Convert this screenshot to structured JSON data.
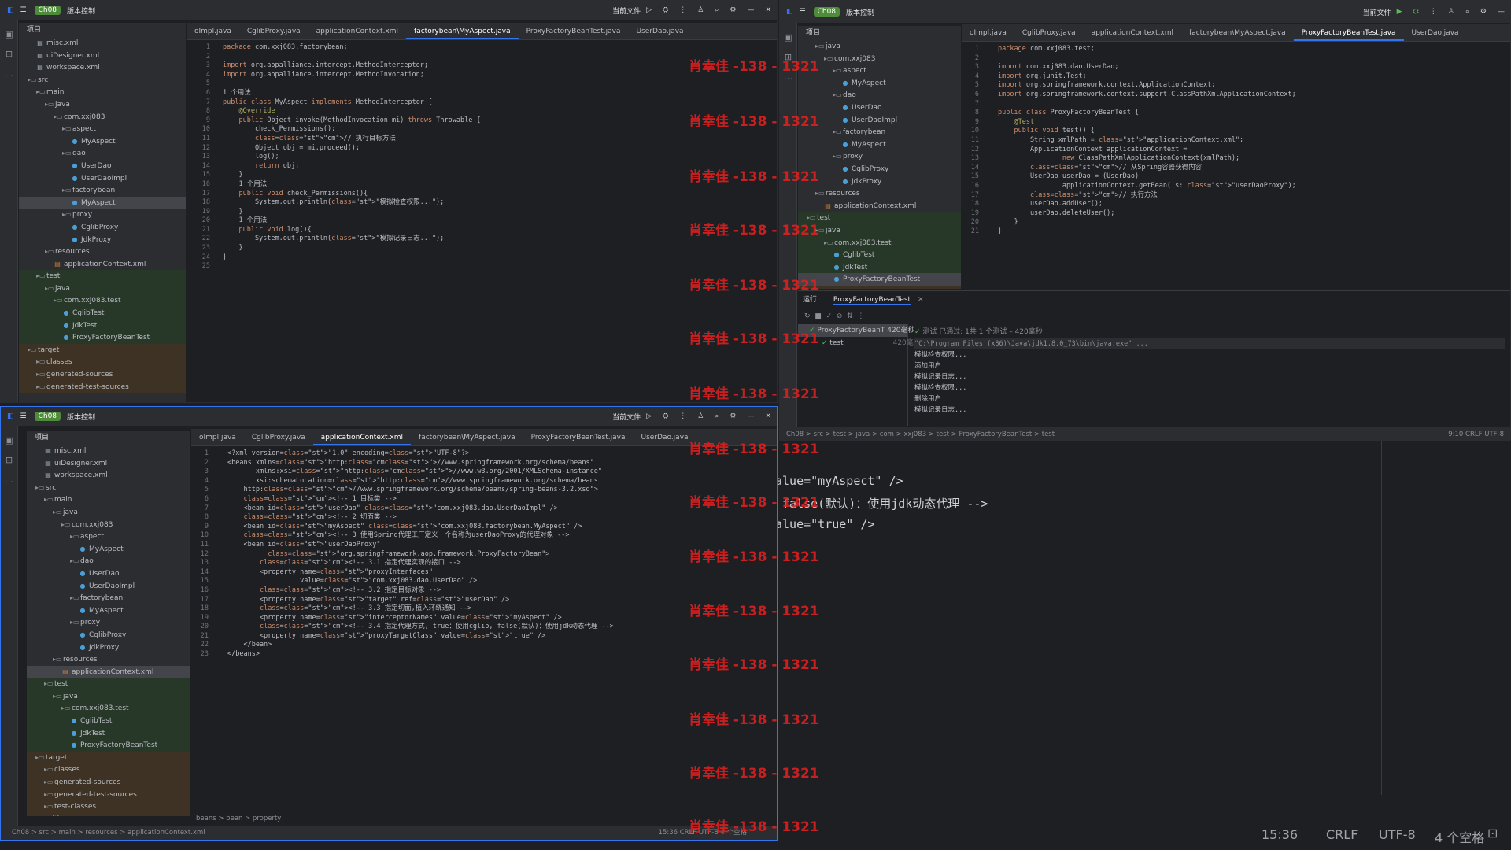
{
  "project": "Ch08",
  "vcs": "版本控制",
  "cur_file": "当前文件",
  "tree_root": "项目",
  "tree": [
    [
      "misc.xml",
      "f",
      2
    ],
    [
      "uiDesigner.xml",
      "f",
      2
    ],
    [
      "workspace.xml",
      "f",
      2
    ],
    [
      "src",
      "d",
      1
    ],
    [
      "main",
      "d",
      2
    ],
    [
      "java",
      "d",
      3
    ],
    [
      "com.xxj083",
      "d",
      4
    ],
    [
      "aspect",
      "d",
      5
    ],
    [
      "MyAspect",
      "c",
      6
    ],
    [
      "dao",
      "d",
      5
    ],
    [
      "UserDao",
      "c",
      6
    ],
    [
      "UserDaoImpl",
      "c",
      6
    ],
    [
      "factorybean",
      "d",
      5
    ],
    [
      "MyAspect",
      "c",
      6
    ],
    [
      "proxy",
      "d",
      5
    ],
    [
      "CglibProxy",
      "c",
      6
    ],
    [
      "JdkProxy",
      "c",
      6
    ],
    [
      "resources",
      "d",
      3
    ],
    [
      "applicationContext.xml",
      "x",
      4
    ],
    [
      "test",
      "d",
      2
    ],
    [
      "java",
      "d",
      3
    ],
    [
      "com.xxj083.test",
      "d",
      4
    ],
    [
      "CglibTest",
      "c",
      5
    ],
    [
      "JdkTest",
      "c",
      5
    ],
    [
      "ProxyFactoryBeanTest",
      "c",
      5
    ],
    [
      "target",
      "d",
      1
    ],
    [
      "classes",
      "d",
      2
    ],
    [
      "generated-sources",
      "d",
      2
    ],
    [
      "generated-test-sources",
      "d",
      2
    ]
  ],
  "tree_b": [
    [
      "misc.xml",
      "f",
      2
    ],
    [
      "uiDesigner.xml",
      "f",
      2
    ],
    [
      "workspace.xml",
      "f",
      2
    ],
    [
      "src",
      "d",
      1
    ],
    [
      "main",
      "d",
      2
    ],
    [
      "java",
      "d",
      3
    ],
    [
      "com.xxj083",
      "d",
      4
    ],
    [
      "aspect",
      "d",
      5
    ],
    [
      "MyAspect",
      "c",
      6
    ],
    [
      "dao",
      "d",
      5
    ],
    [
      "UserDao",
      "c",
      6
    ],
    [
      "UserDaoImpl",
      "c",
      6
    ],
    [
      "factorybean",
      "d",
      5
    ],
    [
      "MyAspect",
      "c",
      6
    ],
    [
      "proxy",
      "d",
      5
    ],
    [
      "CglibProxy",
      "c",
      6
    ],
    [
      "JdkProxy",
      "c",
      6
    ],
    [
      "resources",
      "d",
      3
    ],
    [
      "applicationContext.xml",
      "x",
      4
    ],
    [
      "test",
      "d",
      2
    ],
    [
      "java",
      "d",
      3
    ],
    [
      "com.xxj083.test",
      "d",
      4
    ],
    [
      "CglibTest",
      "c",
      5
    ],
    [
      "JdkTest",
      "c",
      5
    ],
    [
      "ProxyFactoryBeanTest",
      "c",
      5
    ],
    [
      "target",
      "d",
      1
    ],
    [
      "classes",
      "d",
      2
    ],
    [
      "generated-sources",
      "d",
      2
    ],
    [
      "generated-test-sources",
      "d",
      2
    ],
    [
      "test-classes",
      "d",
      2
    ],
    [
      ".gitignore",
      "f",
      1
    ]
  ],
  "tree_r": [
    [
      "java",
      "d",
      2
    ],
    [
      "com.xxj083",
      "d",
      3
    ],
    [
      "aspect",
      "d",
      4
    ],
    [
      "MyAspect",
      "c",
      5
    ],
    [
      "dao",
      "d",
      4
    ],
    [
      "UserDao",
      "c",
      5
    ],
    [
      "UserDaoImpl",
      "c",
      5
    ],
    [
      "factorybean",
      "d",
      4
    ],
    [
      "MyAspect",
      "c",
      5
    ],
    [
      "proxy",
      "d",
      4
    ],
    [
      "CglibProxy",
      "c",
      5
    ],
    [
      "JdkProxy",
      "c",
      5
    ],
    [
      "resources",
      "d",
      2
    ],
    [
      "applicationContext.xml",
      "x",
      3
    ],
    [
      "test",
      "d",
      1
    ],
    [
      "java",
      "d",
      2
    ],
    [
      "com.xxj083.test",
      "d",
      3
    ],
    [
      "CglibTest",
      "c",
      4
    ],
    [
      "JdkTest",
      "c",
      4
    ],
    [
      "ProxyFactoryBeanTest",
      "c",
      4
    ],
    [
      "target",
      "d",
      1
    ]
  ],
  "tabs_a": [
    "oImpl.java",
    "CglibProxy.java",
    "applicationContext.xml",
    "factorybean\\MyAspect.java",
    "ProxyFactoryBeanTest.java",
    "UserDao.java"
  ],
  "tabs_r": [
    "oImpl.java",
    "CglibProxy.java",
    "applicationContext.xml",
    "factorybean\\MyAspect.java",
    "ProxyFactoryBeanTest.java",
    "UserDao.java"
  ],
  "code_a": [
    "package com.xxj083.factorybean;",
    "",
    "import org.aopalliance.intercept.MethodInterceptor;",
    "import org.aopalliance.intercept.MethodInvocation;",
    "",
    "1 个用法",
    "public class MyAspect implements MethodInterceptor {",
    "    @Override",
    "    public Object invoke(MethodInvocation mi) throws Throwable {",
    "        check_Permissions();",
    "        // 执行目标方法",
    "        Object obj = mi.proceed();",
    "        log();",
    "        return obj;",
    "    }",
    "    1 个用法",
    "    public void check_Permissions(){",
    "        System.out.println(\"模拟检查权限...\");",
    "    }",
    "    1 个用法",
    "    public void log(){",
    "        System.out.println(\"模拟记录日志...\");",
    "    }",
    "}",
    ""
  ],
  "code_r": [
    "package com.xxj083.test;",
    "",
    "import com.xxj083.dao.UserDao;",
    "import org.junit.Test;",
    "import org.springframework.context.ApplicationContext;",
    "import org.springframework.context.support.ClassPathXmlApplicationContext;",
    "",
    "public class ProxyFactoryBeanTest {",
    "    @Test",
    "    public void test() {",
    "        String xmlPath = \"applicationContext.xml\";",
    "        ApplicationContext applicationContext =",
    "                new ClassPathXmlApplicationContext(xmlPath);",
    "        // 从Spring容器获得内容",
    "        UserDao userDao = (UserDao)",
    "                applicationContext.getBean( s: \"userDaoProxy\");",
    "        // 执行方法",
    "        userDao.addUser();",
    "        userDao.deleteUser();",
    "    }",
    "}"
  ],
  "code_b": [
    "<?xml version=\"1.0\" encoding=\"UTF-8\"?>",
    "<beans xmlns=\"http://www.springframework.org/schema/beans\"",
    "       xmlns:xsi=\"http://www.w3.org/2001/XMLSchema-instance\"",
    "       xsi:schemaLocation=\"http://www.springframework.org/schema/beans",
    "    http://www.springframework.org/schema/beans/spring-beans-3.2.xsd\">",
    "    <!-- 1 目标类 -->",
    "    <bean id=\"userDao\" class=\"com.xxj083.dao.UserDaoImpl\" />",
    "    <!-- 2 切面类 -->",
    "    <bean id=\"myAspect\" class=\"com.xxj083.factorybean.MyAspect\" />",
    "    <!-- 3 使用Spring代理工厂定义一个名称为userDaoProxy的代理对象 -->",
    "    <bean id=\"userDaoProxy\"",
    "          class=\"org.springframework.aop.framework.ProxyFactoryBean\">",
    "        <!-- 3.1 指定代理实现的接口 -->",
    "        <property name=\"proxyInterfaces\"",
    "                  value=\"com.xxj083.dao.UserDao\" />",
    "        <!-- 3.2 指定目标对象 -->",
    "        <property name=\"target\" ref=\"userDao\" />",
    "        <!-- 3.3 指定切面,植入环绕通知 -->",
    "        <property name=\"interceptorNames\" value=\"myAspect\" />",
    "        <!-- 3.4 指定代理方式, true：使用cglib, false(默认)：使用jdk动态代理 -->",
    "        <property name=\"proxyTargetClass\" value=\"true\" />",
    "    </bean>",
    "</beans>"
  ],
  "run": {
    "tool": "运行",
    "tab": "ProxyFactoryBeanTest",
    "node": "ProxyFactoryBeanT 420毫秒",
    "child": "test",
    "child_time": "420毫秒",
    "summary": "测试 已通过: 1共 1 个测试 – 420毫秒",
    "out": [
      "\"C:\\Program Files (x86)\\Java\\jdk1.8.0_73\\bin\\java.exe\" ...",
      "模拟检查权限...",
      "添加用户",
      "模拟记录日志...",
      "模拟检查权限...",
      "删除用户",
      "模拟记录日志..."
    ]
  },
  "crumb_r": "Ch08 > src > test > java > com > xxj083 > test > ProxyFactoryBeanTest > test",
  "pos_r": "9:10   CRLF   UTF-8",
  "crumb_b": "beans  >  bean  >  property",
  "status_b": "Ch08 > src > main > resources > applicationContext.xml",
  "pos_b": "15:36   CRLF   UTF-8   4 个空格",
  "bg_lines": [
    "alue=\"myAspect\" />",
    " false(默认)：使用jdk动态代理 -->",
    "alue=\"true\" />"
  ],
  "bg_status": {
    "pos": "15:36",
    "crlf": "CRLF",
    "enc": "UTF-8",
    "indent": "4 个空格"
  },
  "watermark": "肖幸佳 -138 - 1321"
}
